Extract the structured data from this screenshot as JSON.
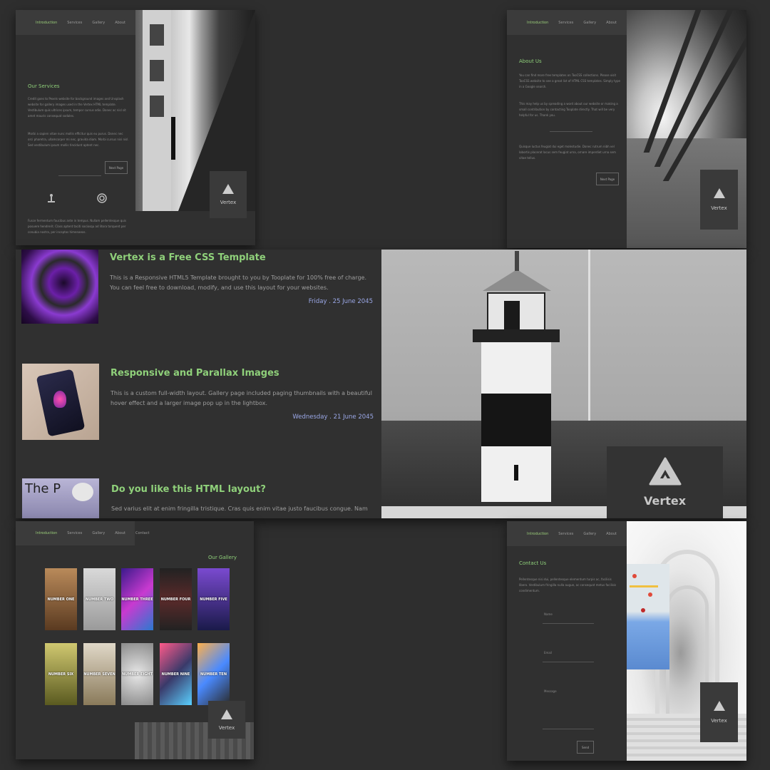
{
  "nav": {
    "items": [
      "Introduction",
      "Services",
      "Gallery",
      "About",
      "Contact"
    ]
  },
  "brand": "Vertex",
  "services": {
    "title": "Our Services",
    "para1": "Credit goes to Pexels website for background images and Unsplash website for gallery images used in the Vertex HTML template. Vestibulum quis ultrices ipsum, tempor cursus odio. Donec ac nisl sit amet mauris consequat sodales.",
    "para2": "Morbi a sapien vitae nunc mollis efficitur quis eu purus. Donec nec orci pharetra, ullamcorper mi nec, gravida diam. Morbi cursus nisi nisl. Sed vestibulum ipsum mollis tincidunt aptent nec.",
    "button": "Next Page",
    "para3": "Fusce fermentum faucibus ante in tempus. Nullam pellentesque quis posuere hendrerit. Class aptent taciti sociosqu ad litora torquent per conubia nostra, per inceptos himenaeos."
  },
  "about": {
    "title": "About Us",
    "para1": "You can find more free templates on TooCSS collections. Please visit TooCSS website to see a great list of HTML CSS templates. Simply type in a Google search.",
    "para2": "This may help us by spreading a word about our website or making a small contribution by contacting Tooplate directly. That will be very helpful for us. Thank you.",
    "para3": "Quisque luctus feugiat dui eget molestudie. Donec rutrum nibh vel lobortis placerat lacus sem feugiat urna, ornare imperdiet urna sem vitae tellus.",
    "button": "Next Page"
  },
  "articles": [
    {
      "title": "Vertex is a Free CSS Template",
      "body": "This is a Responsive HTML5 Template brought to you by Tooplate for 100% free of charge. You can feel free to download, modify, and use this layout for your websites.",
      "date": "Friday . 25 June 2045"
    },
    {
      "title": "Responsive and Parallax Images",
      "body": "This is a custom full-width layout. Gallery page included paging thumbnails with a beautiful hover effect and a larger image pop up in the lightbox.",
      "date": "Wednesday . 21 June 2045"
    },
    {
      "title": "Do you like this HTML layout?",
      "body": "Sed varius elit at enim fringilla tristique. Cras quis enim vitae justo faucibus congue. Nam",
      "thumb_text": "The P"
    }
  ],
  "gallery": {
    "title": "Our Gallery",
    "items": [
      "NUMBER ONE",
      "NUMBER TWO",
      "NUMBER THREE",
      "NUMBER FOUR",
      "NUMBER FIVE",
      "NUMBER SIX",
      "NUMBER SEVEN",
      "NUMBER EIGHT",
      "NUMBER NINE",
      "NUMBER TEN"
    ]
  },
  "contact": {
    "title": "Contact Us",
    "intro": "Pellentesque nisi dui, pellentesque elementum turpis ac, facilisis libero. Vestibulum fringilla nulla augue, ac consequat metus facilisis condimentum.",
    "name_label": "Name",
    "email_label": "Email",
    "message_label": "Message",
    "send": "Send"
  },
  "colors": {
    "background": "#2e2e2e",
    "panel": "#303030",
    "nav": "#3b3b3b",
    "accent_green": "#8fd07a",
    "date_blue": "#9aa7e6"
  }
}
